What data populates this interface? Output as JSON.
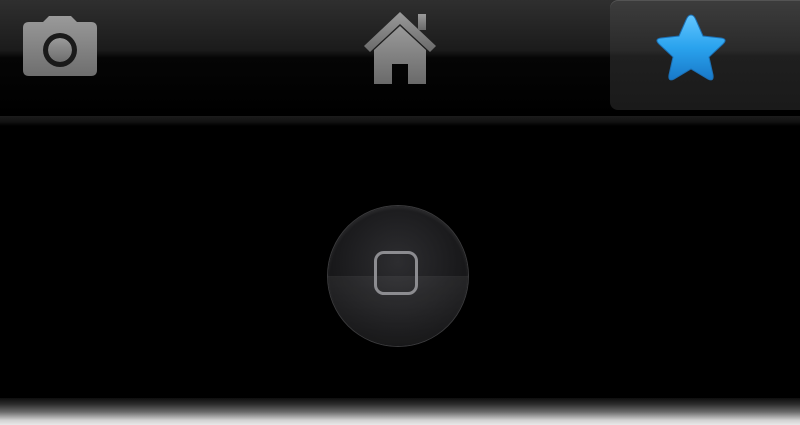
{
  "tab_bar": {
    "tabs": [
      {
        "icon": "camera-icon",
        "selected": false
      },
      {
        "icon": "home-icon",
        "selected": false
      },
      {
        "icon": "star-icon",
        "selected": true,
        "color": "#2aa3ee"
      }
    ]
  },
  "colors": {
    "icon_gray": "#8a8a8a",
    "star_blue": "#2aa3ee",
    "background": "#000000"
  },
  "hardware": {
    "home_button": "home-button-icon"
  }
}
